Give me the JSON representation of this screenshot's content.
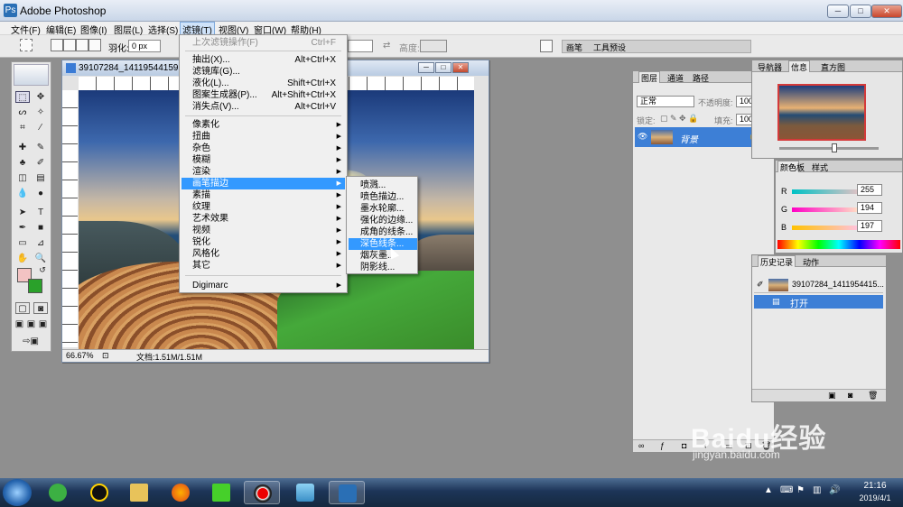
{
  "app": {
    "title": "Adobe Photoshop"
  },
  "menubar": {
    "items": [
      "文件(F)",
      "编辑(E)",
      "图像(I)",
      "图层(L)",
      "选择(S)",
      "滤镜(T)",
      "视图(V)",
      "窗口(W)",
      "帮助(H)"
    ]
  },
  "options": {
    "feather_label": "羽化:",
    "feather_value": "0 px",
    "height_label": "高度:",
    "well_tabs": [
      "画笔",
      "工具预设"
    ]
  },
  "document": {
    "title": "39107284_1411954415925",
    "zoom": "66.67%",
    "doc_info": "文档:1.51M/1.51M"
  },
  "filter_menu": {
    "items": [
      {
        "label": "上次滤镜操作(F)",
        "shortcut": "Ctrl+F",
        "disabled": true
      },
      {
        "label": "抽出(X)...",
        "shortcut": "Alt+Ctrl+X"
      },
      {
        "label": "滤镜库(G)..."
      },
      {
        "label": "液化(L)...",
        "shortcut": "Shift+Ctrl+X"
      },
      {
        "label": "图案生成器(P)...",
        "shortcut": "Alt+Shift+Ctrl+X"
      },
      {
        "label": "消失点(V)...",
        "shortcut": "Alt+Ctrl+V"
      },
      {
        "label": "像素化"
      },
      {
        "label": "扭曲"
      },
      {
        "label": "杂色"
      },
      {
        "label": "模糊"
      },
      {
        "label": "渲染"
      },
      {
        "label": "画笔描边",
        "highlighted": true
      },
      {
        "label": "素描"
      },
      {
        "label": "纹理"
      },
      {
        "label": "艺术效果"
      },
      {
        "label": "视频"
      },
      {
        "label": "锐化"
      },
      {
        "label": "风格化"
      },
      {
        "label": "其它"
      },
      {
        "label": "Digimarc"
      }
    ]
  },
  "brush_submenu": {
    "items": [
      "喷溅...",
      "喷色描边...",
      "墨水轮廓...",
      "强化的边缘...",
      "成角的线条...",
      "深色线条...",
      "烟灰墨...",
      "阴影线..."
    ],
    "highlighted_index": 5
  },
  "layers_panel": {
    "tabs": [
      "图层",
      "通道",
      "路径"
    ],
    "blend_mode": "正常",
    "opacity_label": "不透明度:",
    "opacity_value": "100%",
    "lock_label": "锁定:",
    "fill_label": "填充:",
    "fill_value": "100%",
    "layer_name": "背景"
  },
  "navigator_panel": {
    "tabs": [
      "导航器",
      "信息",
      "直方图"
    ]
  },
  "color_panel": {
    "tabs": [
      "颜色",
      "色板",
      "样式"
    ],
    "r_label": "R",
    "r_value": "255",
    "g_label": "G",
    "g_value": "194",
    "b_label": "B",
    "b_value": "197",
    "foreground_color": "#f3c3c3",
    "background_color": "#2aa12a"
  },
  "history_panel": {
    "tabs": [
      "历史记录",
      "动作"
    ],
    "snapshot_name": "39107284_1411954415...",
    "step_name": "打开"
  },
  "taskbar": {
    "time": "21:16",
    "date": "2019/4/1"
  },
  "watermark": {
    "main": "Baidu经验",
    "url": "jingyan.baidu.com"
  }
}
